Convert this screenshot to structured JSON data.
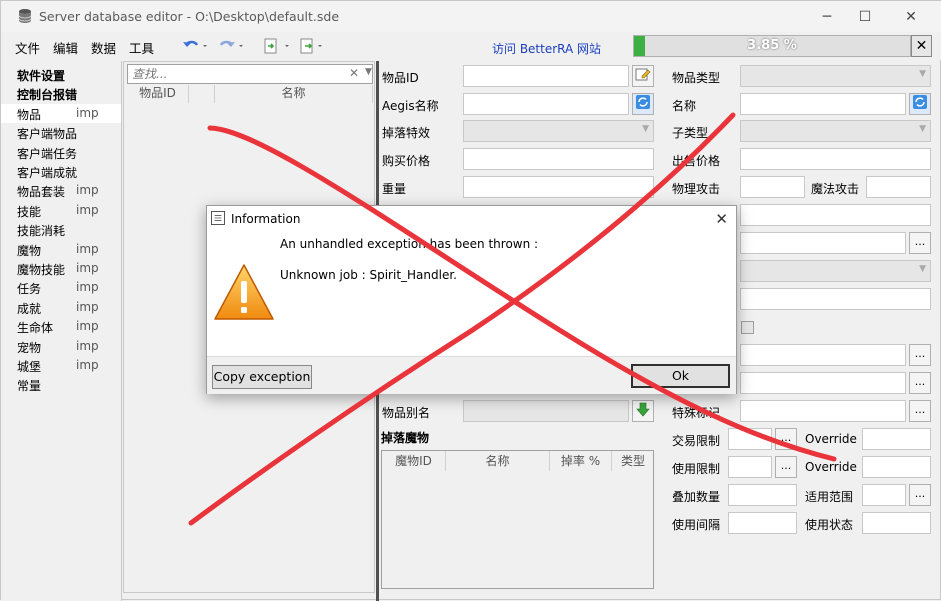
{
  "window": {
    "title": "Server database editor - O:\\Desktop\\default.sde",
    "icon": "database-icon",
    "controls": {
      "minimize": "─",
      "maximize": "☐",
      "close": "✕"
    }
  },
  "menu": {
    "items": [
      "文件",
      "编辑",
      "数据",
      "工具"
    ],
    "betterra_link": "访问 BetterRA 网站"
  },
  "progress": {
    "text": "3.85 %",
    "value": 0.0385,
    "close": "✕",
    "color": "#3cb043"
  },
  "sidebar": {
    "items": [
      {
        "label": "软件设置",
        "imp": "",
        "bold": true
      },
      {
        "label": "控制台报错",
        "imp": "",
        "bold": true
      },
      {
        "label": "物品",
        "imp": "imp",
        "selected": true
      },
      {
        "label": "客户端物品",
        "imp": ""
      },
      {
        "label": "客户端任务",
        "imp": ""
      },
      {
        "label": "客户端成就",
        "imp": ""
      },
      {
        "label": "物品套装",
        "imp": "imp"
      },
      {
        "label": "技能",
        "imp": "imp"
      },
      {
        "label": "技能消耗",
        "imp": ""
      },
      {
        "label": "魔物",
        "imp": "imp"
      },
      {
        "label": "魔物技能",
        "imp": "imp"
      },
      {
        "label": "任务",
        "imp": "imp"
      },
      {
        "label": "成就",
        "imp": "imp"
      },
      {
        "label": "生命体",
        "imp": "imp"
      },
      {
        "label": "宠物",
        "imp": "imp"
      },
      {
        "label": "城堡",
        "imp": "imp"
      },
      {
        "label": "常量",
        "imp": ""
      }
    ]
  },
  "list": {
    "search_placeholder": "查找...",
    "columns": [
      "物品ID",
      "名称"
    ]
  },
  "form": {
    "item_id": "物品ID",
    "aegis_name": "Aegis名称",
    "drop_effect": "掉落特效",
    "buy_price": "购买价格",
    "weight": "重量",
    "item_type": "物品类型",
    "name": "名称",
    "sub_type": "子类型",
    "sell_price": "出售价格",
    "phys_attack": "物理攻击",
    "magic_attack": "魔法攻击",
    "item_alias": "物品别名",
    "special_flag": "特殊标记",
    "trade_limit": "交易限制",
    "use_limit": "使用限制",
    "override": "Override",
    "stack_count": "叠加数量",
    "apply_range": "适用范围",
    "use_interval": "使用间隔",
    "use_state": "使用状态",
    "ellipsis": "...",
    "drop_monsters": "掉落魔物",
    "drop_columns": [
      "魔物ID",
      "名称",
      "掉率 %",
      "类型"
    ]
  },
  "dialog": {
    "title": "Information",
    "line1": "An unhandled exception has been thrown :",
    "line2": "Unknown job : Spirit_Handler.",
    "copy_button": "Copy exception",
    "ok_button": "Ok",
    "close": "✕"
  },
  "overlay": {
    "color": "#e8343a"
  }
}
